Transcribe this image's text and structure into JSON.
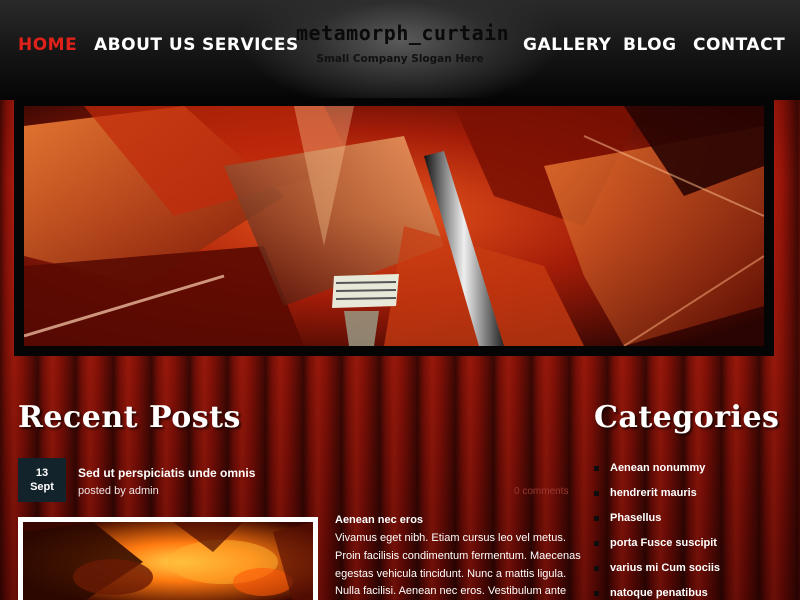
{
  "header": {
    "logo_title": "metamorph_curtain",
    "logo_slogan": "Small Company Slogan Here",
    "nav": [
      {
        "label": "HOME",
        "active": true
      },
      {
        "label": "ABOUT US",
        "active": false
      },
      {
        "label": "SERVICES",
        "active": false
      },
      {
        "label": "GALLERY",
        "active": false
      },
      {
        "label": "BLOG",
        "active": false
      },
      {
        "label": "CONTACT",
        "active": false
      }
    ]
  },
  "recent_posts": {
    "heading": "Recent Posts",
    "post": {
      "date_day": "13",
      "date_month": "Sept",
      "title": "Sed ut perspiciatis unde omnis",
      "author": "posted by admin",
      "comments": "0 comments",
      "excerpt_title": "Aenean nec eros",
      "excerpt_lines": [
        "Vivamus eget nibh. Etiam cursus leo vel metus.",
        "Proin facilisis condimentum fermentum. Maecenas",
        "egestas vehicula tincidunt. Nunc a mattis ligula.",
        "Nulla facilisi. Aenean nec eros. Vestibulum ante"
      ]
    }
  },
  "categories": {
    "heading": "Categories",
    "items": [
      "Aenean nonummy",
      "hendrerit mauris",
      "Phasellus",
      "porta Fusce suscipit",
      "varius mi Cum sociis",
      "natoque penatibus"
    ]
  },
  "colors": {
    "accent_red": "#e0201a",
    "date_box": "#13232c",
    "curtain_red": "#a0150a"
  }
}
